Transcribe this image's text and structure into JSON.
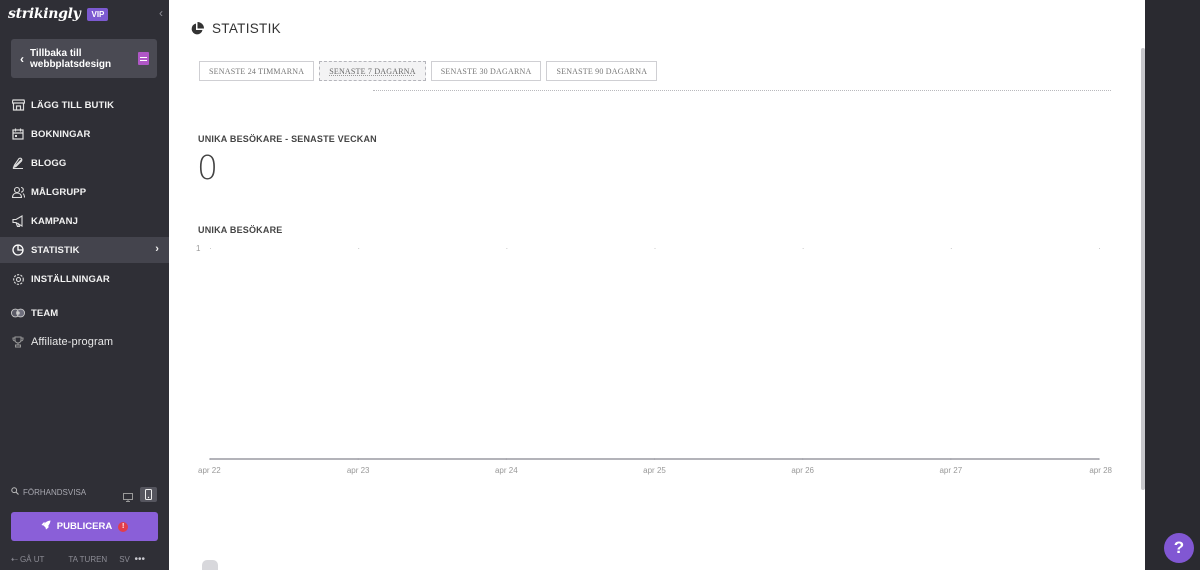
{
  "brand": {
    "name": "strikingly",
    "badge": "VIP"
  },
  "sidebar": {
    "back_label": "Tillbaka till webbplatsdesign",
    "items": [
      {
        "label": "LÄGG TILL BUTIK",
        "icon": "store-icon"
      },
      {
        "label": "BOKNINGAR",
        "icon": "calendar-icon"
      },
      {
        "label": "BLOGG",
        "icon": "pen-icon"
      },
      {
        "label": "MÅLGRUPP",
        "icon": "audience-icon"
      },
      {
        "label": "KAMPANJ",
        "icon": "megaphone-icon"
      },
      {
        "label": "STATISTIK",
        "icon": "pie-chart-icon",
        "active": true
      },
      {
        "label": "INSTÄLLNINGAR",
        "icon": "gear-icon"
      },
      {
        "label": "TEAM",
        "icon": "team-icon"
      },
      {
        "label": "Affiliate-program",
        "icon": "trophy-icon"
      }
    ],
    "preview_label": "FÖRHANDSVISA",
    "publish_label": "PUBLICERA",
    "publish_alert": "!",
    "footer": {
      "exit": "GÅ UT",
      "tour": "TA TUREN",
      "lang": "SV"
    }
  },
  "main": {
    "title": "STATISTIK",
    "tabs": [
      {
        "label": "SENASTE 24 TIMMARNA",
        "active": false
      },
      {
        "label": "SENASTE 7 DAGARNA",
        "active": true
      },
      {
        "label": "SENASTE 30 DAGARNA",
        "active": false
      },
      {
        "label": "SENASTE 90 DAGARNA",
        "active": false
      }
    ],
    "metric_label": "UNIKA BESÖKARE - SENASTE VECKAN",
    "metric_value": "0",
    "chart_label": "UNIKA BESÖKARE"
  },
  "help_label": "?",
  "colors": {
    "accent": "#8a5fd8",
    "sidebar_bg": "#2f2f36",
    "alert": "#e23d4b"
  },
  "chart_data": {
    "type": "line",
    "title": "UNIKA BESÖKARE",
    "categories": [
      "apr 22",
      "apr 23",
      "apr 24",
      "apr 25",
      "apr 26",
      "apr 27",
      "apr 28"
    ],
    "series": [
      {
        "values": [
          0,
          0,
          0,
          0,
          0,
          0,
          0
        ]
      }
    ],
    "ylim": [
      0,
      1
    ],
    "yticks": [
      "1"
    ],
    "grid": false
  }
}
